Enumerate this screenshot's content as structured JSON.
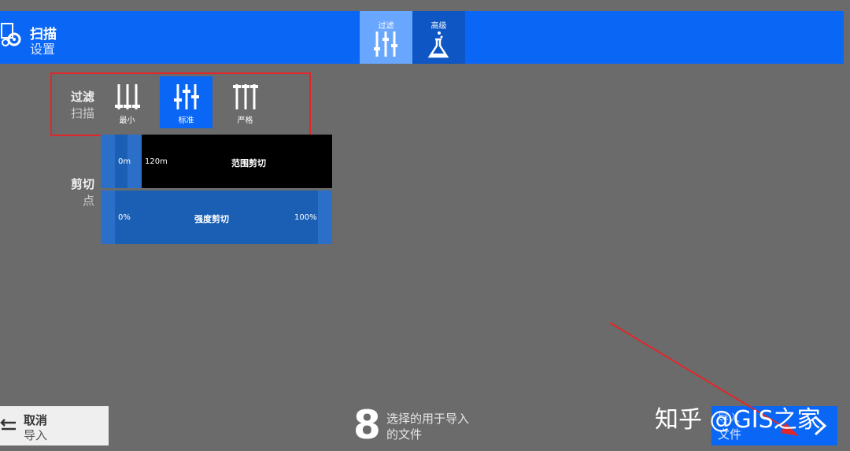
{
  "header": {
    "title_main": "扫描",
    "title_sub": "设置",
    "tabs": [
      {
        "label": "过滤",
        "icon": "sliders-icon",
        "active": true
      },
      {
        "label": "高级",
        "icon": "flask-icon",
        "active": false
      }
    ]
  },
  "filter_group": {
    "label_main": "过滤",
    "label_sub": "扫描",
    "options": [
      {
        "label": "最小",
        "icon": "sliders-low-icon",
        "selected": false
      },
      {
        "label": "标准",
        "icon": "sliders-mid-icon",
        "selected": true
      },
      {
        "label": "严格",
        "icon": "sliders-high-icon",
        "selected": false
      }
    ]
  },
  "clip_group": {
    "label_main": "剪切",
    "label_sub": "点",
    "range_slider": {
      "min_label": "0m",
      "max_label": "120m",
      "title": "范围剪切"
    },
    "intensity_slider": {
      "min_label": "0%",
      "max_label": "100%",
      "title": "强度剪切"
    }
  },
  "footer": {
    "cancel_main": "取消",
    "cancel_sub": "导入",
    "selected_count": "8",
    "count_text_line1": "选择的用于导入",
    "count_text_line2": "的文件",
    "import_main": "导入",
    "import_sub": "文件"
  },
  "watermark": "知乎 @GIS之家",
  "colors": {
    "accent": "#0a66f5",
    "background": "#6b6b6b",
    "highlight": "#e0282b"
  }
}
